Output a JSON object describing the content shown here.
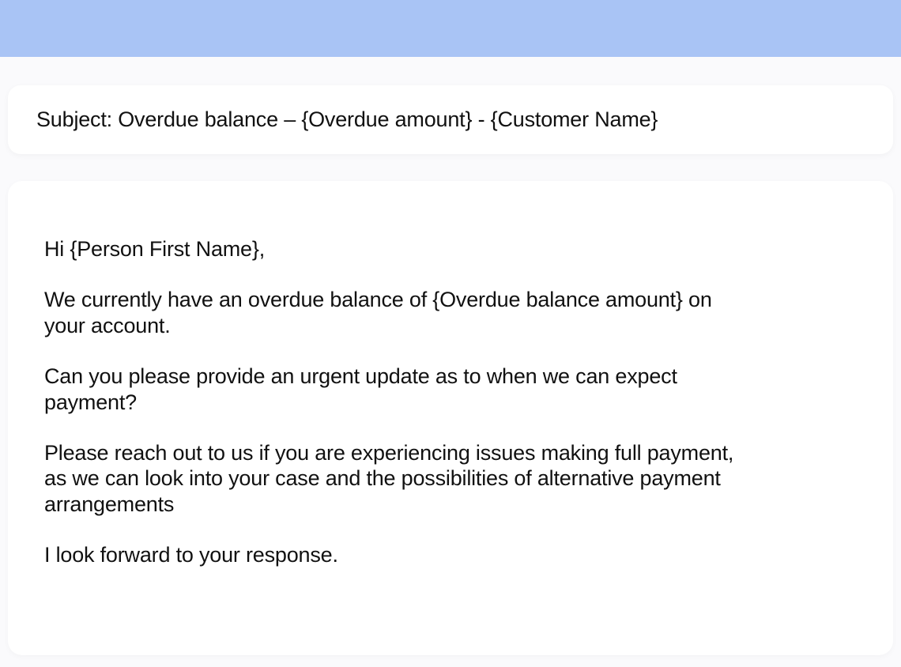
{
  "subject": "Subject: Overdue balance – {Overdue amount} - {Customer Name}",
  "body": {
    "greeting": "Hi {Person First Name},",
    "p1": "We currently have an overdue balance of {Overdue balance amount} on your account.",
    "p2": "Can you please provide an urgent update as to when we can expect payment?",
    "p3": "Please reach out to us if you are experiencing issues making full payment, as we can look into your case and the possibilities of alternative payment arrangements",
    "closing": "I look forward to your response."
  }
}
